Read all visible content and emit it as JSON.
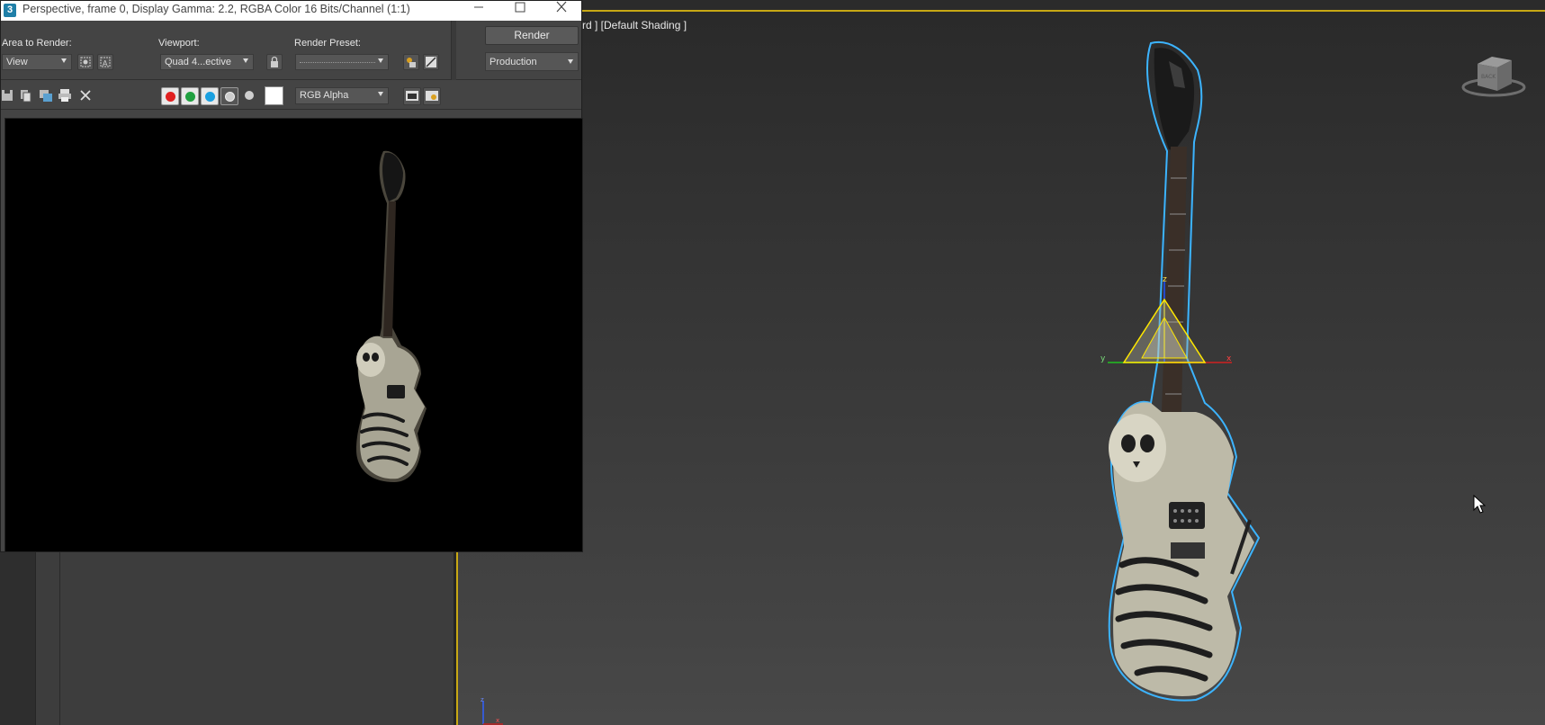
{
  "viewport": {
    "label": "rd ] [Default Shading ]",
    "viewcube_icon": "viewcube-icon",
    "axis_labels": {
      "z": "z",
      "x": "x",
      "y": "y"
    },
    "tripod_labels": {
      "z": "z",
      "x": "x"
    }
  },
  "render_window": {
    "app_icon_text": "3",
    "title": "Perspective, frame 0, Display Gamma: 2.2, RGBA Color 16 Bits/Channel (1:1)",
    "area_to_render": {
      "label": "Area to Render:",
      "value": "View"
    },
    "viewport_select": {
      "label": "Viewport:",
      "value": "Quad 4...ective"
    },
    "render_preset": {
      "label": "Render Preset:",
      "value": ""
    },
    "render_button": "Render",
    "render_mode": {
      "value": "Production"
    },
    "channel_display": {
      "value": "RGB Alpha"
    },
    "channel_colors": {
      "red": "#e02020",
      "green": "#20a040",
      "blue": "#1aa0e0"
    }
  },
  "colors": {
    "accent": "#c8a814",
    "selection_outline": "#3cb4ff"
  }
}
